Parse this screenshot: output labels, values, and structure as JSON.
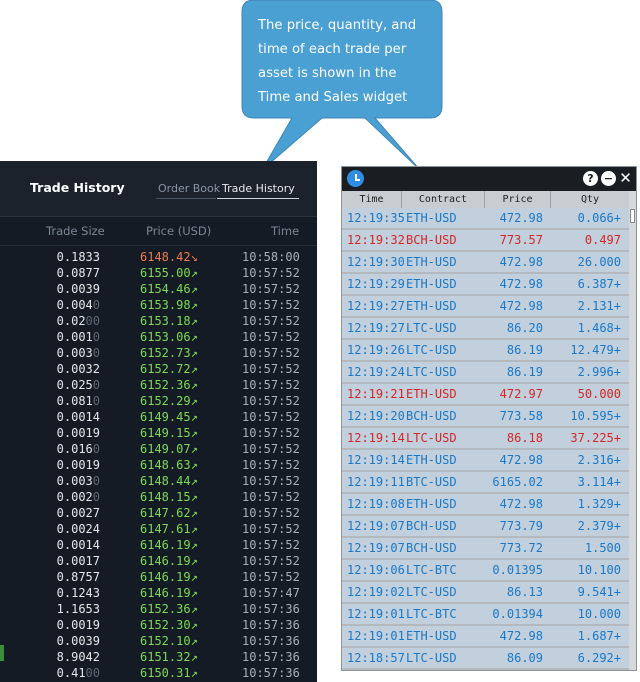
{
  "callout": {
    "text": "The price, quantity, and time of each trade per asset is shown in the Time and Sales widget",
    "fill": "#4a9fd3"
  },
  "trade_history": {
    "title": "Trade History",
    "tabs": [
      "Order Book",
      "Trade History"
    ],
    "active_tab": "Trade History",
    "columns": {
      "size": "Trade Size",
      "price": "Price (USD)",
      "time": "Time"
    },
    "colors": {
      "up": "#7ed957",
      "down": "#f07a4f",
      "background": "#151b24"
    },
    "rows": [
      {
        "size": "0.1833",
        "size_dim": "",
        "price": "6148.42",
        "dir": "down",
        "arrow": "↘",
        "time": "10:58:00"
      },
      {
        "size": "0.0877",
        "size_dim": "",
        "price": "6155.00",
        "dir": "up",
        "arrow": "↗",
        "time": "10:57:52"
      },
      {
        "size": "0.0039",
        "size_dim": "",
        "price": "6154.46",
        "dir": "up",
        "arrow": "↗",
        "time": "10:57:52"
      },
      {
        "size": "0.004",
        "size_dim": "0",
        "price": "6153.98",
        "dir": "up",
        "arrow": "↗",
        "time": "10:57:52"
      },
      {
        "size": "0.02",
        "size_dim": "00",
        "price": "6153.18",
        "dir": "up",
        "arrow": "↗",
        "time": "10:57:52"
      },
      {
        "size": "0.001",
        "size_dim": "0",
        "price": "6153.06",
        "dir": "up",
        "arrow": "↗",
        "time": "10:57:52"
      },
      {
        "size": "0.003",
        "size_dim": "0",
        "price": "6152.73",
        "dir": "up",
        "arrow": "↗",
        "time": "10:57:52"
      },
      {
        "size": "0.0032",
        "size_dim": "",
        "price": "6152.72",
        "dir": "up",
        "arrow": "↗",
        "time": "10:57:52"
      },
      {
        "size": "0.025",
        "size_dim": "0",
        "price": "6152.36",
        "dir": "up",
        "arrow": "↗",
        "time": "10:57:52"
      },
      {
        "size": "0.081",
        "size_dim": "0",
        "price": "6152.29",
        "dir": "up",
        "arrow": "↗",
        "time": "10:57:52"
      },
      {
        "size": "0.0014",
        "size_dim": "",
        "price": "6149.45",
        "dir": "up",
        "arrow": "↗",
        "time": "10:57:52"
      },
      {
        "size": "0.0019",
        "size_dim": "",
        "price": "6149.15",
        "dir": "up",
        "arrow": "↗",
        "time": "10:57:52"
      },
      {
        "size": "0.016",
        "size_dim": "0",
        "price": "6149.07",
        "dir": "up",
        "arrow": "↗",
        "time": "10:57:52"
      },
      {
        "size": "0.0019",
        "size_dim": "",
        "price": "6148.63",
        "dir": "up",
        "arrow": "↗",
        "time": "10:57:52"
      },
      {
        "size": "0.003",
        "size_dim": "0",
        "price": "6148.44",
        "dir": "up",
        "arrow": "↗",
        "time": "10:57:52"
      },
      {
        "size": "0.002",
        "size_dim": "0",
        "price": "6148.15",
        "dir": "up",
        "arrow": "↗",
        "time": "10:57:52"
      },
      {
        "size": "0.0027",
        "size_dim": "",
        "price": "6147.62",
        "dir": "up",
        "arrow": "↗",
        "time": "10:57:52"
      },
      {
        "size": "0.0024",
        "size_dim": "",
        "price": "6147.61",
        "dir": "up",
        "arrow": "↗",
        "time": "10:57:52"
      },
      {
        "size": "0.0014",
        "size_dim": "",
        "price": "6146.19",
        "dir": "up",
        "arrow": "↗",
        "time": "10:57:52"
      },
      {
        "size": "0.0017",
        "size_dim": "",
        "price": "6146.19",
        "dir": "up",
        "arrow": "↗",
        "time": "10:57:52"
      },
      {
        "size": "0.8757",
        "size_dim": "",
        "price": "6146.19",
        "dir": "up",
        "arrow": "↗",
        "time": "10:57:52"
      },
      {
        "size": "0.1243",
        "size_dim": "",
        "price": "6146.19",
        "dir": "up",
        "arrow": "↗",
        "time": "10:57:47"
      },
      {
        "size": "1.1653",
        "size_dim": "",
        "price": "6152.36",
        "dir": "up",
        "arrow": "↗",
        "time": "10:57:36"
      },
      {
        "size": "0.0019",
        "size_dim": "",
        "price": "6152.30",
        "dir": "up",
        "arrow": "↗",
        "time": "10:57:36"
      },
      {
        "size": "0.0039",
        "size_dim": "",
        "price": "6152.10",
        "dir": "up",
        "arrow": "↗",
        "time": "10:57:36"
      },
      {
        "size": "8.9042",
        "size_dim": "",
        "price": "6151.32",
        "dir": "up",
        "arrow": "↗",
        "time": "10:57:36"
      },
      {
        "size": "0.41",
        "size_dim": "00",
        "price": "6150.31",
        "dir": "up",
        "arrow": "↗",
        "time": "10:57:36"
      }
    ]
  },
  "time_and_sales": {
    "columns": {
      "time": "Time",
      "contract": "Contract",
      "price": "Price",
      "qty": "Qty"
    },
    "controls": {
      "help": "?",
      "minimize": "−",
      "close": "✕"
    },
    "colors": {
      "buy": "#1a78c8",
      "sell": "#d42626",
      "row": "#c1d0dc"
    },
    "rows": [
      {
        "time": "12:19:35",
        "contract": "ETH-USD",
        "price": "472.98",
        "qty": "0.066+",
        "side": "buy"
      },
      {
        "time": "12:19:32",
        "contract": "BCH-USD",
        "price": "773.57",
        "qty": "0.497",
        "side": "sell"
      },
      {
        "time": "12:19:30",
        "contract": "ETH-USD",
        "price": "472.98",
        "qty": "26.000",
        "side": "buy"
      },
      {
        "time": "12:19:29",
        "contract": "ETH-USD",
        "price": "472.98",
        "qty": "6.387+",
        "side": "buy"
      },
      {
        "time": "12:19:27",
        "contract": "ETH-USD",
        "price": "472.98",
        "qty": "2.131+",
        "side": "buy"
      },
      {
        "time": "12:19:27",
        "contract": "LTC-USD",
        "price": "86.20",
        "qty": "1.468+",
        "side": "buy"
      },
      {
        "time": "12:19:26",
        "contract": "LTC-USD",
        "price": "86.19",
        "qty": "12.479+",
        "side": "buy"
      },
      {
        "time": "12:19:24",
        "contract": "LTC-USD",
        "price": "86.19",
        "qty": "2.996+",
        "side": "buy"
      },
      {
        "time": "12:19:21",
        "contract": "ETH-USD",
        "price": "472.97",
        "qty": "50.000",
        "side": "sell"
      },
      {
        "time": "12:19:20",
        "contract": "BCH-USD",
        "price": "773.58",
        "qty": "10.595+",
        "side": "buy"
      },
      {
        "time": "12:19:14",
        "contract": "LTC-USD",
        "price": "86.18",
        "qty": "37.225+",
        "side": "sell"
      },
      {
        "time": "12:19:14",
        "contract": "ETH-USD",
        "price": "472.98",
        "qty": "2.316+",
        "side": "buy"
      },
      {
        "time": "12:19:11",
        "contract": "BTC-USD",
        "price": "6165.02",
        "qty": "3.114+",
        "side": "buy"
      },
      {
        "time": "12:19:08",
        "contract": "ETH-USD",
        "price": "472.98",
        "qty": "1.329+",
        "side": "buy"
      },
      {
        "time": "12:19:07",
        "contract": "BCH-USD",
        "price": "773.79",
        "qty": "2.379+",
        "side": "buy"
      },
      {
        "time": "12:19:07",
        "contract": "BCH-USD",
        "price": "773.72",
        "qty": "1.500",
        "side": "buy"
      },
      {
        "time": "12:19:06",
        "contract": "LTC-BTC",
        "price": "0.01395",
        "qty": "10.100",
        "side": "buy"
      },
      {
        "time": "12:19:02",
        "contract": "LTC-USD",
        "price": "86.13",
        "qty": "9.541+",
        "side": "buy"
      },
      {
        "time": "12:19:01",
        "contract": "LTC-BTC",
        "price": "0.01394",
        "qty": "10.000",
        "side": "buy"
      },
      {
        "time": "12:19:01",
        "contract": "ETH-USD",
        "price": "472.98",
        "qty": "1.687+",
        "side": "buy"
      },
      {
        "time": "12:18:57",
        "contract": "LTC-USD",
        "price": "86.09",
        "qty": "6.292+",
        "side": "buy"
      }
    ]
  }
}
